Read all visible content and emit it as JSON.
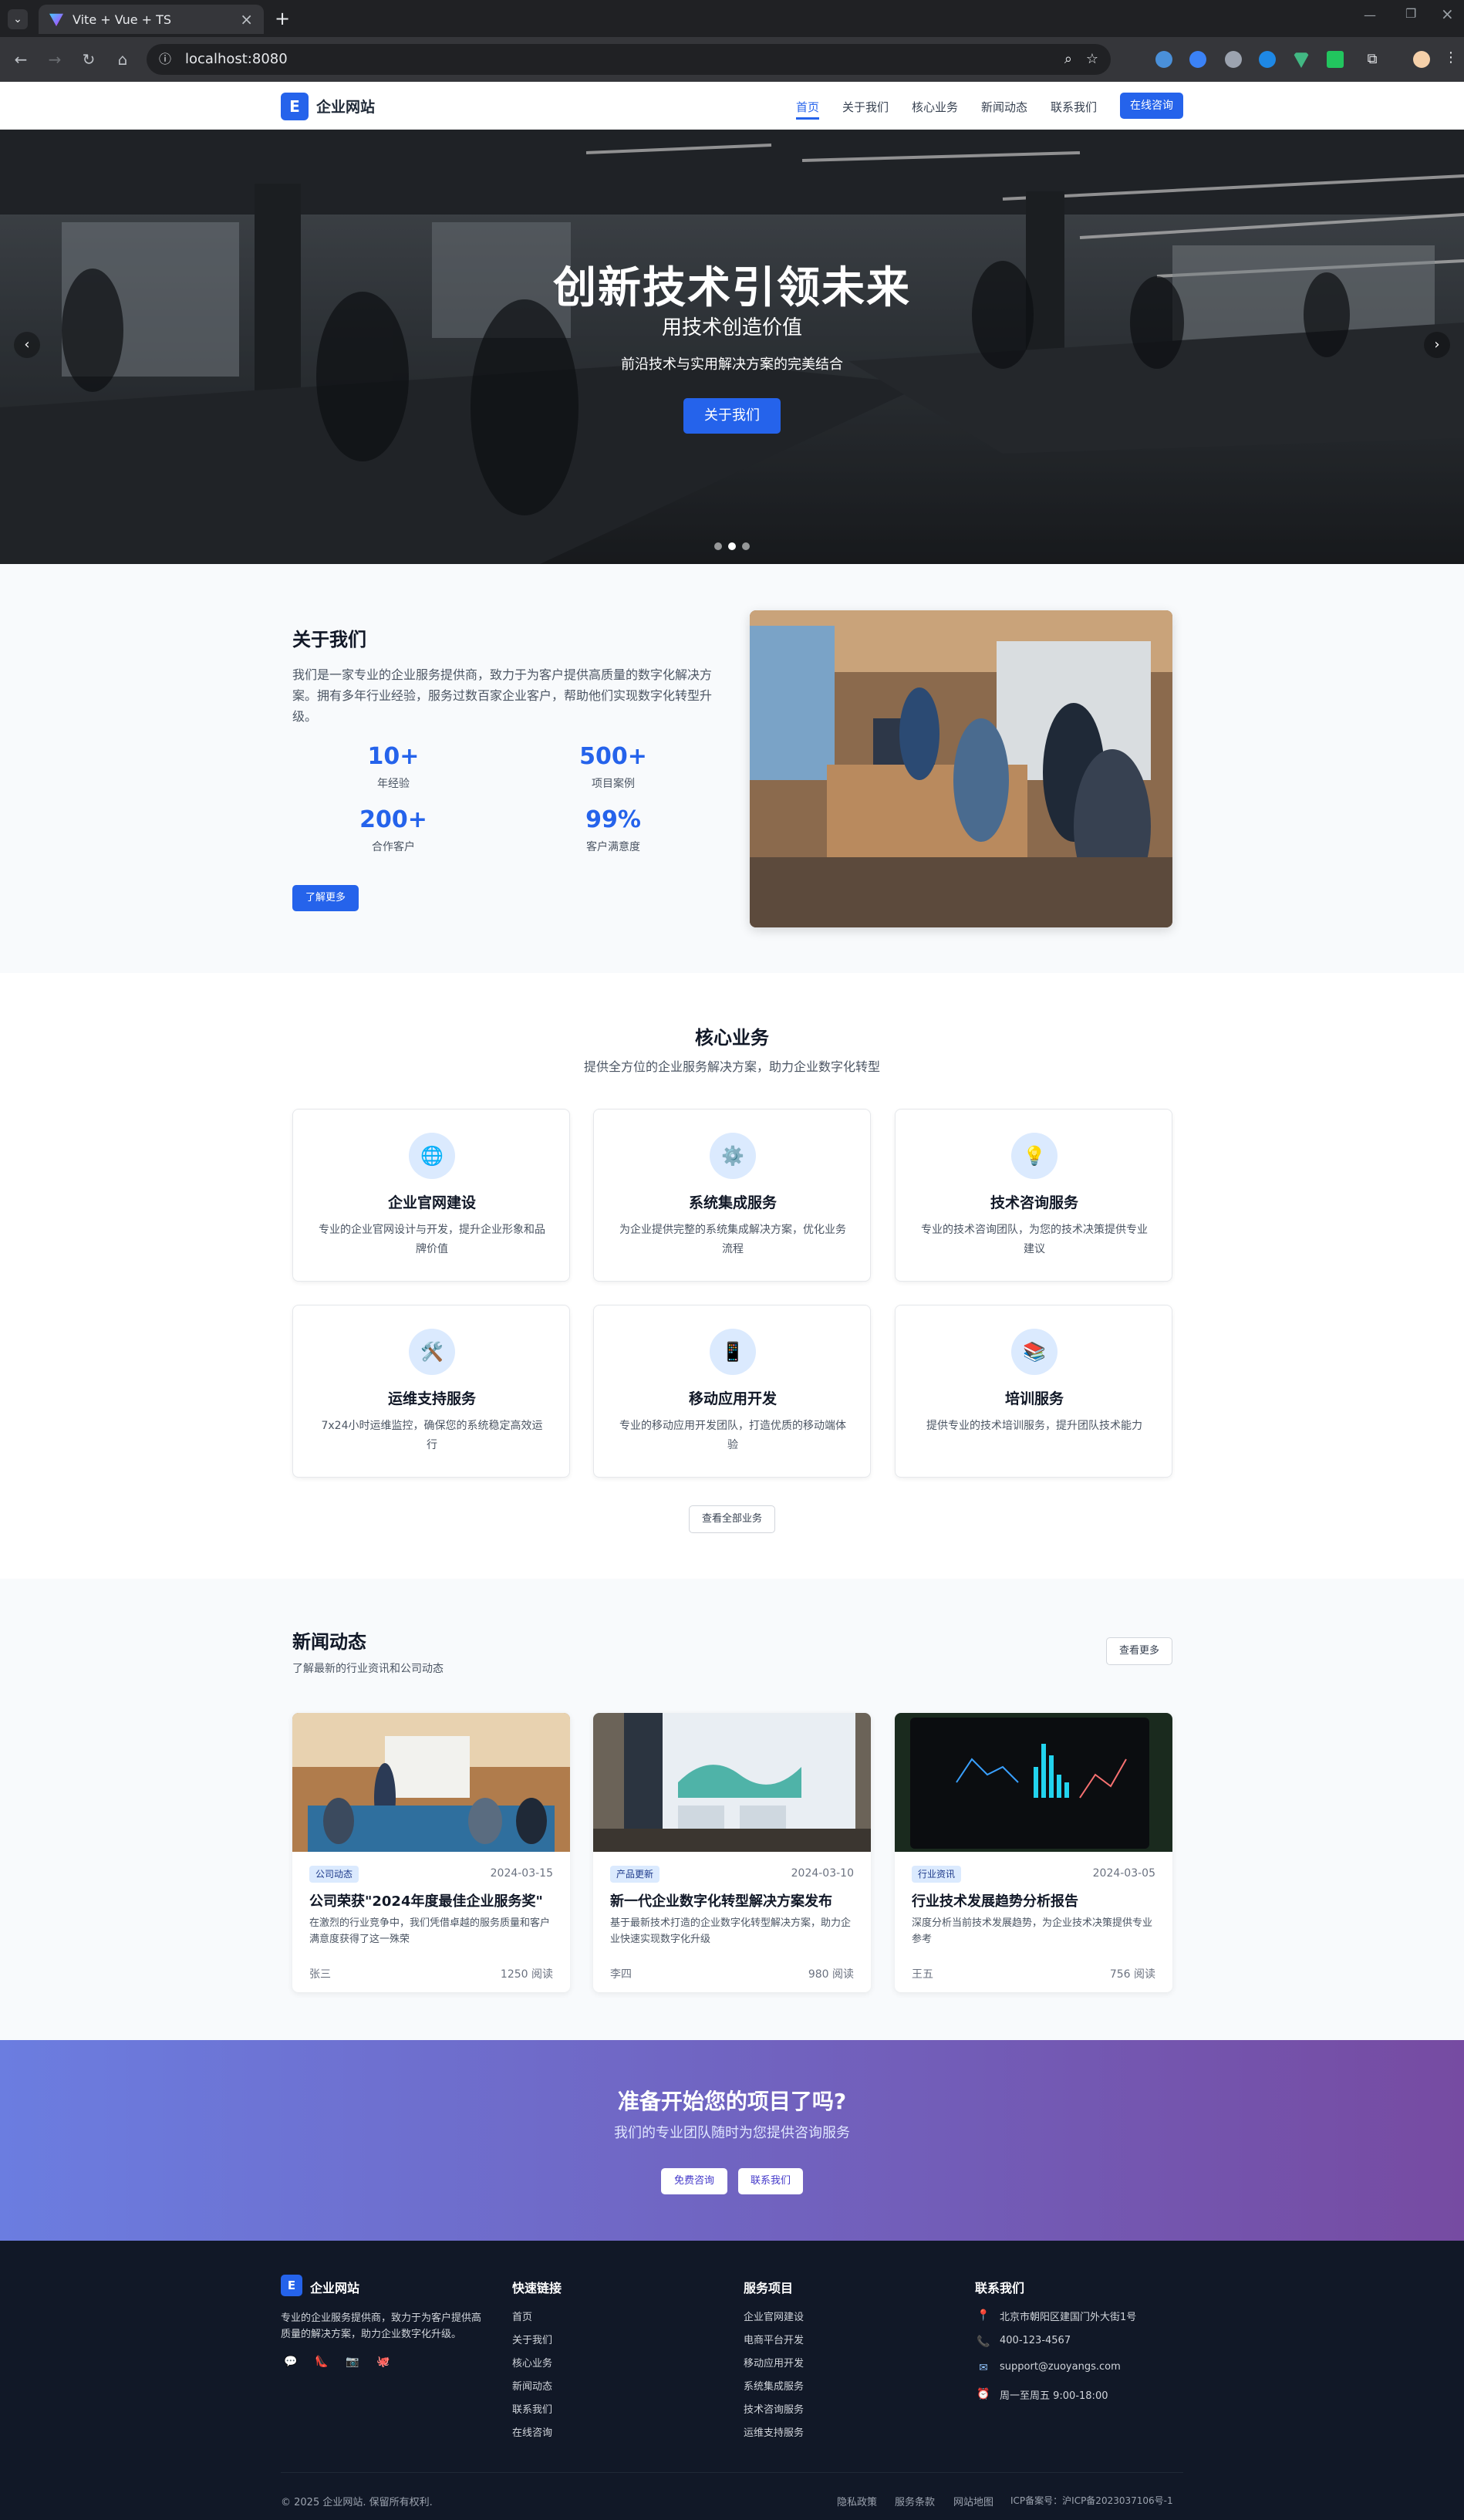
{
  "browser": {
    "tab_title": "Vite + Vue + TS",
    "url": "localhost:8080"
  },
  "header": {
    "logo_letter": "E",
    "logo_text": "企业网站",
    "nav": [
      "首页",
      "关于我们",
      "核心业务",
      "新闻动态",
      "联系我们"
    ],
    "cta": "在线咨询"
  },
  "hero": {
    "title": "创新技术引领未来",
    "subtitle": "用技术创造价值",
    "desc": "前沿技术与实用解决方案的完美结合",
    "button": "关于我们"
  },
  "about": {
    "title": "关于我们",
    "text": "我们是一家专业的企业服务提供商，致力于为客户提供高质量的数字化解决方案。拥有多年行业经验，服务过数百家企业客户，帮助他们实现数字化转型升级。",
    "stats": [
      {
        "num": "10+",
        "label": "年经验"
      },
      {
        "num": "500+",
        "label": "项目案例"
      },
      {
        "num": "200+",
        "label": "合作客户"
      },
      {
        "num": "99%",
        "label": "客户满意度"
      }
    ],
    "button": "了解更多"
  },
  "services": {
    "title": "核心业务",
    "subtitle": "提供全方位的企业服务解决方案，助力企业数字化转型",
    "items": [
      {
        "icon": "globe-icon",
        "glyph": "🌐",
        "title": "企业官网建设",
        "desc": "专业的企业官网设计与开发，提升企业形象和品牌价值"
      },
      {
        "icon": "gear-icon",
        "glyph": "⚙️",
        "title": "系统集成服务",
        "desc": "为企业提供完整的系统集成解决方案，优化业务流程"
      },
      {
        "icon": "lightbulb-icon",
        "glyph": "💡",
        "title": "技术咨询服务",
        "desc": "专业的技术咨询团队，为您的技术决策提供专业建议"
      },
      {
        "icon": "tools-icon",
        "glyph": "🛠️",
        "title": "运维支持服务",
        "desc": "7x24小时运维监控，确保您的系统稳定高效运行"
      },
      {
        "icon": "mobile-icon",
        "glyph": "📱",
        "title": "移动应用开发",
        "desc": "专业的移动应用开发团队，打造优质的移动端体验"
      },
      {
        "icon": "books-icon",
        "glyph": "📚",
        "title": "培训服务",
        "desc": "提供专业的技术培训服务，提升团队技术能力"
      }
    ],
    "button": "查看全部业务"
  },
  "news": {
    "title": "新闻动态",
    "subtitle": "了解最新的行业资讯和公司动态",
    "more": "查看更多",
    "items": [
      {
        "tag": "公司动态",
        "date": "2024-03-15",
        "title": "公司荣获\"2024年度最佳企业服务奖\"",
        "summary": "在激烈的行业竞争中，我们凭借卓越的服务质量和客户满意度获得了这一殊荣",
        "author": "张三",
        "reads": "1250 阅读"
      },
      {
        "tag": "产品更新",
        "date": "2024-03-10",
        "title": "新一代企业数字化转型解决方案发布",
        "summary": "基于最新技术打造的企业数字化转型解决方案，助力企业快速实现数字化升级",
        "author": "李四",
        "reads": "980 阅读"
      },
      {
        "tag": "行业资讯",
        "date": "2024-03-05",
        "title": "行业技术发展趋势分析报告",
        "summary": "深度分析当前技术发展趋势，为企业技术决策提供专业参考",
        "author": "王五",
        "reads": "756 阅读"
      }
    ]
  },
  "cta": {
    "title": "准备开始您的项目了吗?",
    "subtitle": "我们的专业团队随时为您提供咨询服务",
    "btn1": "免费咨询",
    "btn2": "联系我们"
  },
  "footer": {
    "logo_letter": "E",
    "logo_text": "企业网站",
    "desc": "专业的企业服务提供商，致力于为客户提供高质量的解决方案，助力企业数字化升级。",
    "quick_title": "快速链接",
    "quick": [
      "首页",
      "关于我们",
      "核心业务",
      "新闻动态",
      "联系我们",
      "在线咨询"
    ],
    "service_title": "服务项目",
    "service": [
      "企业官网建设",
      "电商平台开发",
      "移动应用开发",
      "系统集成服务",
      "技术咨询服务",
      "运维支持服务"
    ],
    "contact_title": "联系我们",
    "contact": {
      "address": "北京市朝阳区建国门外大街1号",
      "phone": "400-123-4567",
      "email": "support@zuoyangs.com",
      "hours": "周一至周五 9:00-18:00"
    },
    "copyright": "© 2025 企业网站. 保留所有权利.",
    "bottom_links": [
      "隐私政策",
      "服务条款",
      "网站地图",
      "ICP备案号：沪ICP备2023037106号-1"
    ]
  },
  "colors": {
    "primary": "#2563eb",
    "footer_bg": "#111827",
    "cta_start": "#6b7de0",
    "cta_end": "#764ba2"
  }
}
